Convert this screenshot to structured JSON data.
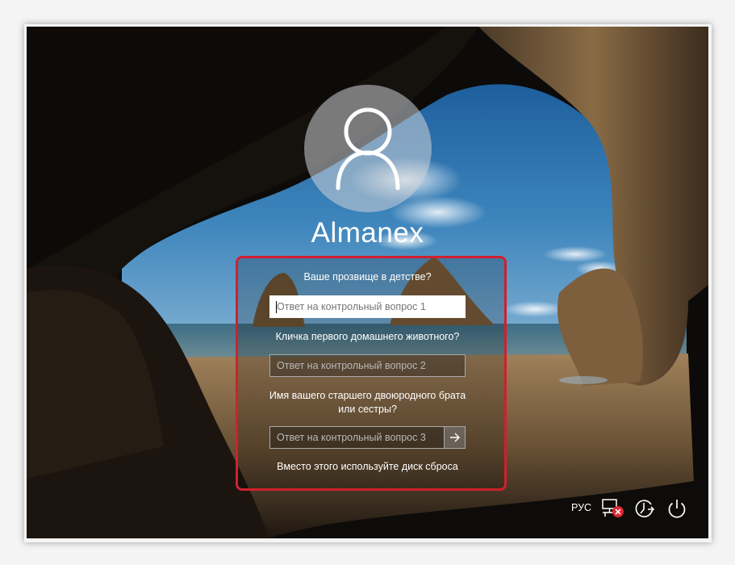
{
  "user": {
    "name": "Almanex"
  },
  "security_questions": [
    {
      "question": "Ваше прозвище в детстве?",
      "placeholder": "Ответ на контрольный вопрос 1"
    },
    {
      "question": "Кличка первого домашнего животного?",
      "placeholder": "Ответ на контрольный вопрос 2"
    },
    {
      "question_line1": "Имя вашего старшего двоюродного брата",
      "question_line2": "или сестры?",
      "placeholder": "Ответ на контрольный вопрос 3"
    }
  ],
  "reset_link": "Вместо этого используйте диск сброса",
  "taskbar": {
    "language": "РУС",
    "icons": [
      "network-disconnected-icon",
      "accessibility-icon",
      "power-icon"
    ]
  },
  "colors": {
    "highlight_border": "#d0202e",
    "text": "#ffffff"
  }
}
